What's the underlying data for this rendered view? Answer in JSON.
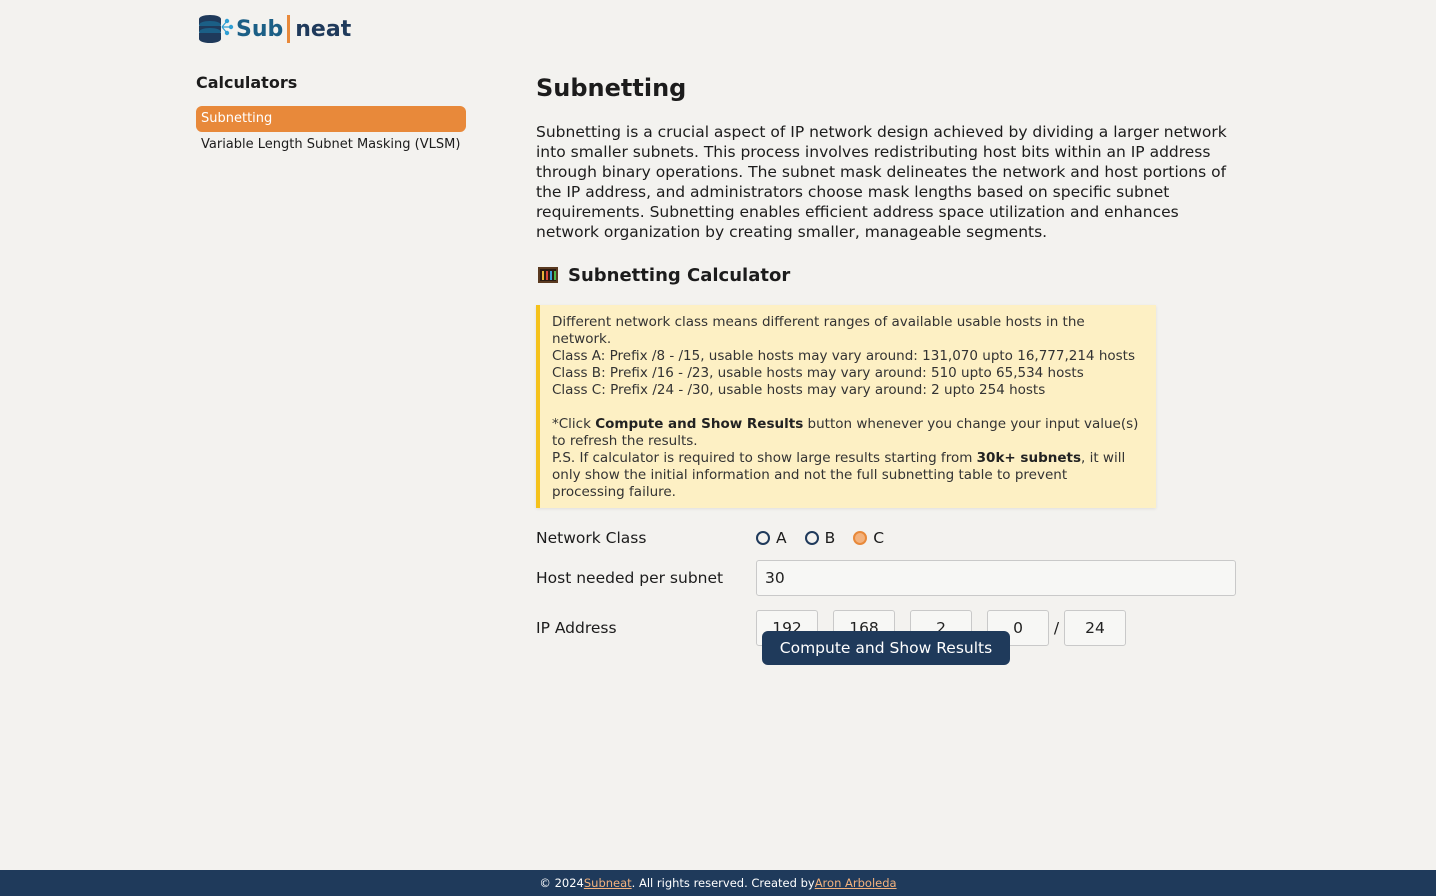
{
  "brand": {
    "name_part1": "Sub",
    "name_part2": "neat",
    "colors": {
      "primary": "#1f3a5b",
      "accent": "#e8893a",
      "sub_blue": "#1b5f86"
    }
  },
  "sidebar": {
    "title": "Calculators",
    "items": [
      {
        "label": "Subnetting",
        "active": true
      },
      {
        "label": "Variable Length Subnet Masking (VLSM)",
        "active": false
      }
    ]
  },
  "main": {
    "title": "Subnetting",
    "intro": "Subnetting is a crucial aspect of IP network design achieved by dividing a larger network into smaller subnets. This process involves redistributing host bits within an IP address through binary operations. The subnet mask delineates the network and host portions of the IP address, and administrators choose mask lengths based on specific subnet requirements. Subnetting enables efficient address space utilization and enhances network organization by creating smaller, manageable segments.",
    "calculator_title": "Subnetting Calculator",
    "calculator_icon": "abacus-icon",
    "note": {
      "line1": "Different network class means different ranges of available usable hosts in the network.",
      "line2": "Class A: Prefix /8 - /15, usable hosts may vary around: 131,070 upto 16,777,214 hosts",
      "line3": "Class B: Prefix /16 - /23, usable hosts may vary around: 510 upto 65,534 hosts",
      "line4": "Class C: Prefix /24 - /30, usable hosts may vary around: 2 upto 254 hosts",
      "click_prefix": "*Click ",
      "click_bold": "Compute and Show Results",
      "click_suffix": " button whenever you change your input value(s) to refresh the results.",
      "ps_prefix": "P.S. If calculator is required to show large results starting from ",
      "ps_bold": "30k+ subnets",
      "ps_suffix": ", it will only show the initial information and not the full subnetting table to prevent processing failure."
    },
    "form": {
      "network_class_label": "Network Class",
      "classes": [
        {
          "label": "A",
          "checked": false
        },
        {
          "label": "B",
          "checked": false
        },
        {
          "label": "C",
          "checked": true
        }
      ],
      "hosts_label": "Host needed per subnet",
      "hosts_value": "30",
      "ip_label": "IP Address",
      "ip_octets": [
        "192",
        "168",
        "2",
        "0"
      ],
      "ip_dot": ".",
      "prefix_sep": "/",
      "prefix": "24",
      "submit_label": "Compute and Show Results"
    }
  },
  "footer": {
    "prefix": "© 2024 ",
    "brand_link": "Subneat",
    "middle": ". All rights reserved. Created by ",
    "author_link": "Aron Arboleda"
  }
}
